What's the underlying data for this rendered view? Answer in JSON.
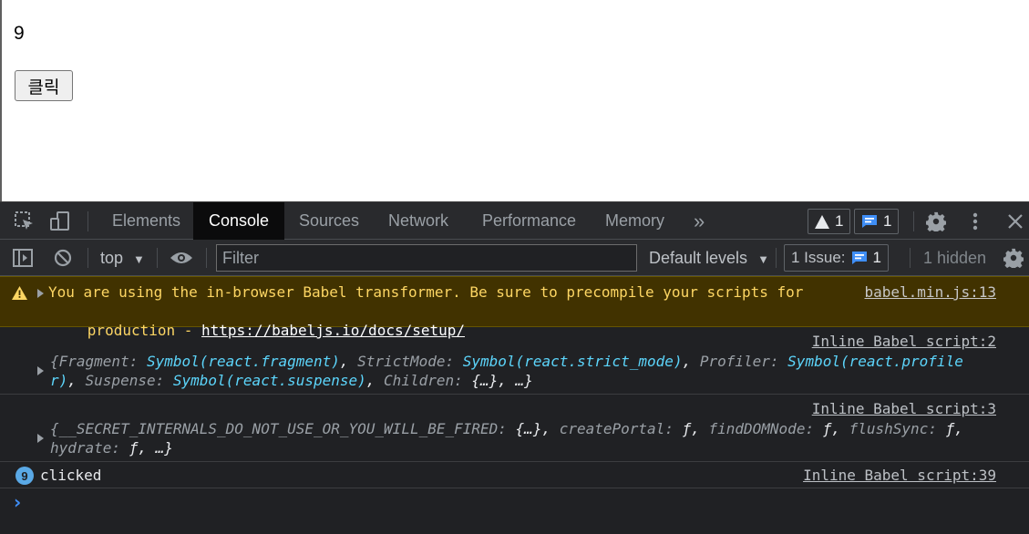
{
  "page": {
    "counter": "9",
    "button_label": "클릭"
  },
  "devtools": {
    "tabs": [
      "Elements",
      "Console",
      "Sources",
      "Network",
      "Performance",
      "Memory"
    ],
    "more_tabs": "»",
    "warnings_count": "1",
    "messages_count": "1",
    "toolbar": {
      "context": "top",
      "filter_placeholder": "Filter",
      "levels": "Default levels",
      "issues_label": "1 Issue:",
      "issues_count": "1",
      "hidden": "1 hidden"
    },
    "console": {
      "warning": {
        "text_line1": "You are using the in-browser Babel transformer. Be sure to precompile your scripts for",
        "text_line2_prefix": "production - ",
        "link": "https://babeljs.io/docs/setup/",
        "source": "babel.min.js:13"
      },
      "log1": {
        "source": "Inline Babel script:2",
        "line1": [
          [
            "k",
            "{Fragment: "
          ],
          [
            "v",
            "Symbol(react.fragment)"
          ],
          [
            "t",
            ", "
          ],
          [
            "k",
            "StrictMode: "
          ],
          [
            "v",
            "Symbol(react.strict_mode)"
          ],
          [
            "t",
            ", "
          ],
          [
            "k",
            "Profiler: "
          ],
          [
            "v",
            "Symbol(react.profile"
          ]
        ],
        "line2": [
          [
            "v",
            "r)"
          ],
          [
            "t",
            ", "
          ],
          [
            "k",
            "Suspense: "
          ],
          [
            "v",
            "Symbol(react.suspense)"
          ],
          [
            "t",
            ", "
          ],
          [
            "k",
            "Children: "
          ],
          [
            "t",
            "{…}, …}"
          ]
        ]
      },
      "log2": {
        "source": "Inline Babel script:3",
        "line1": [
          [
            "k",
            "{__SECRET_INTERNALS_DO_NOT_USE_OR_YOU_WILL_BE_FIRED: "
          ],
          [
            "t",
            "{…}, "
          ],
          [
            "k",
            "createPortal: "
          ],
          [
            "t",
            "ƒ, "
          ],
          [
            "k",
            "findDOMNode: "
          ],
          [
            "t",
            "ƒ, "
          ],
          [
            "k",
            "flushSync: "
          ],
          [
            "t",
            "ƒ,"
          ]
        ],
        "line2": [
          [
            "k",
            "hydrate: "
          ],
          [
            "t",
            "ƒ, …}"
          ]
        ]
      },
      "log3": {
        "repeat_count": "9",
        "text": "clicked",
        "source": "Inline Babel script:39"
      },
      "prompt": "›"
    }
  },
  "colors": {
    "devtools_bg": "#202124",
    "warning_bg": "#413200",
    "warning_text": "#fdd663",
    "value_blue": "#5cd5fb",
    "accent_blue": "#3f8ef6"
  }
}
